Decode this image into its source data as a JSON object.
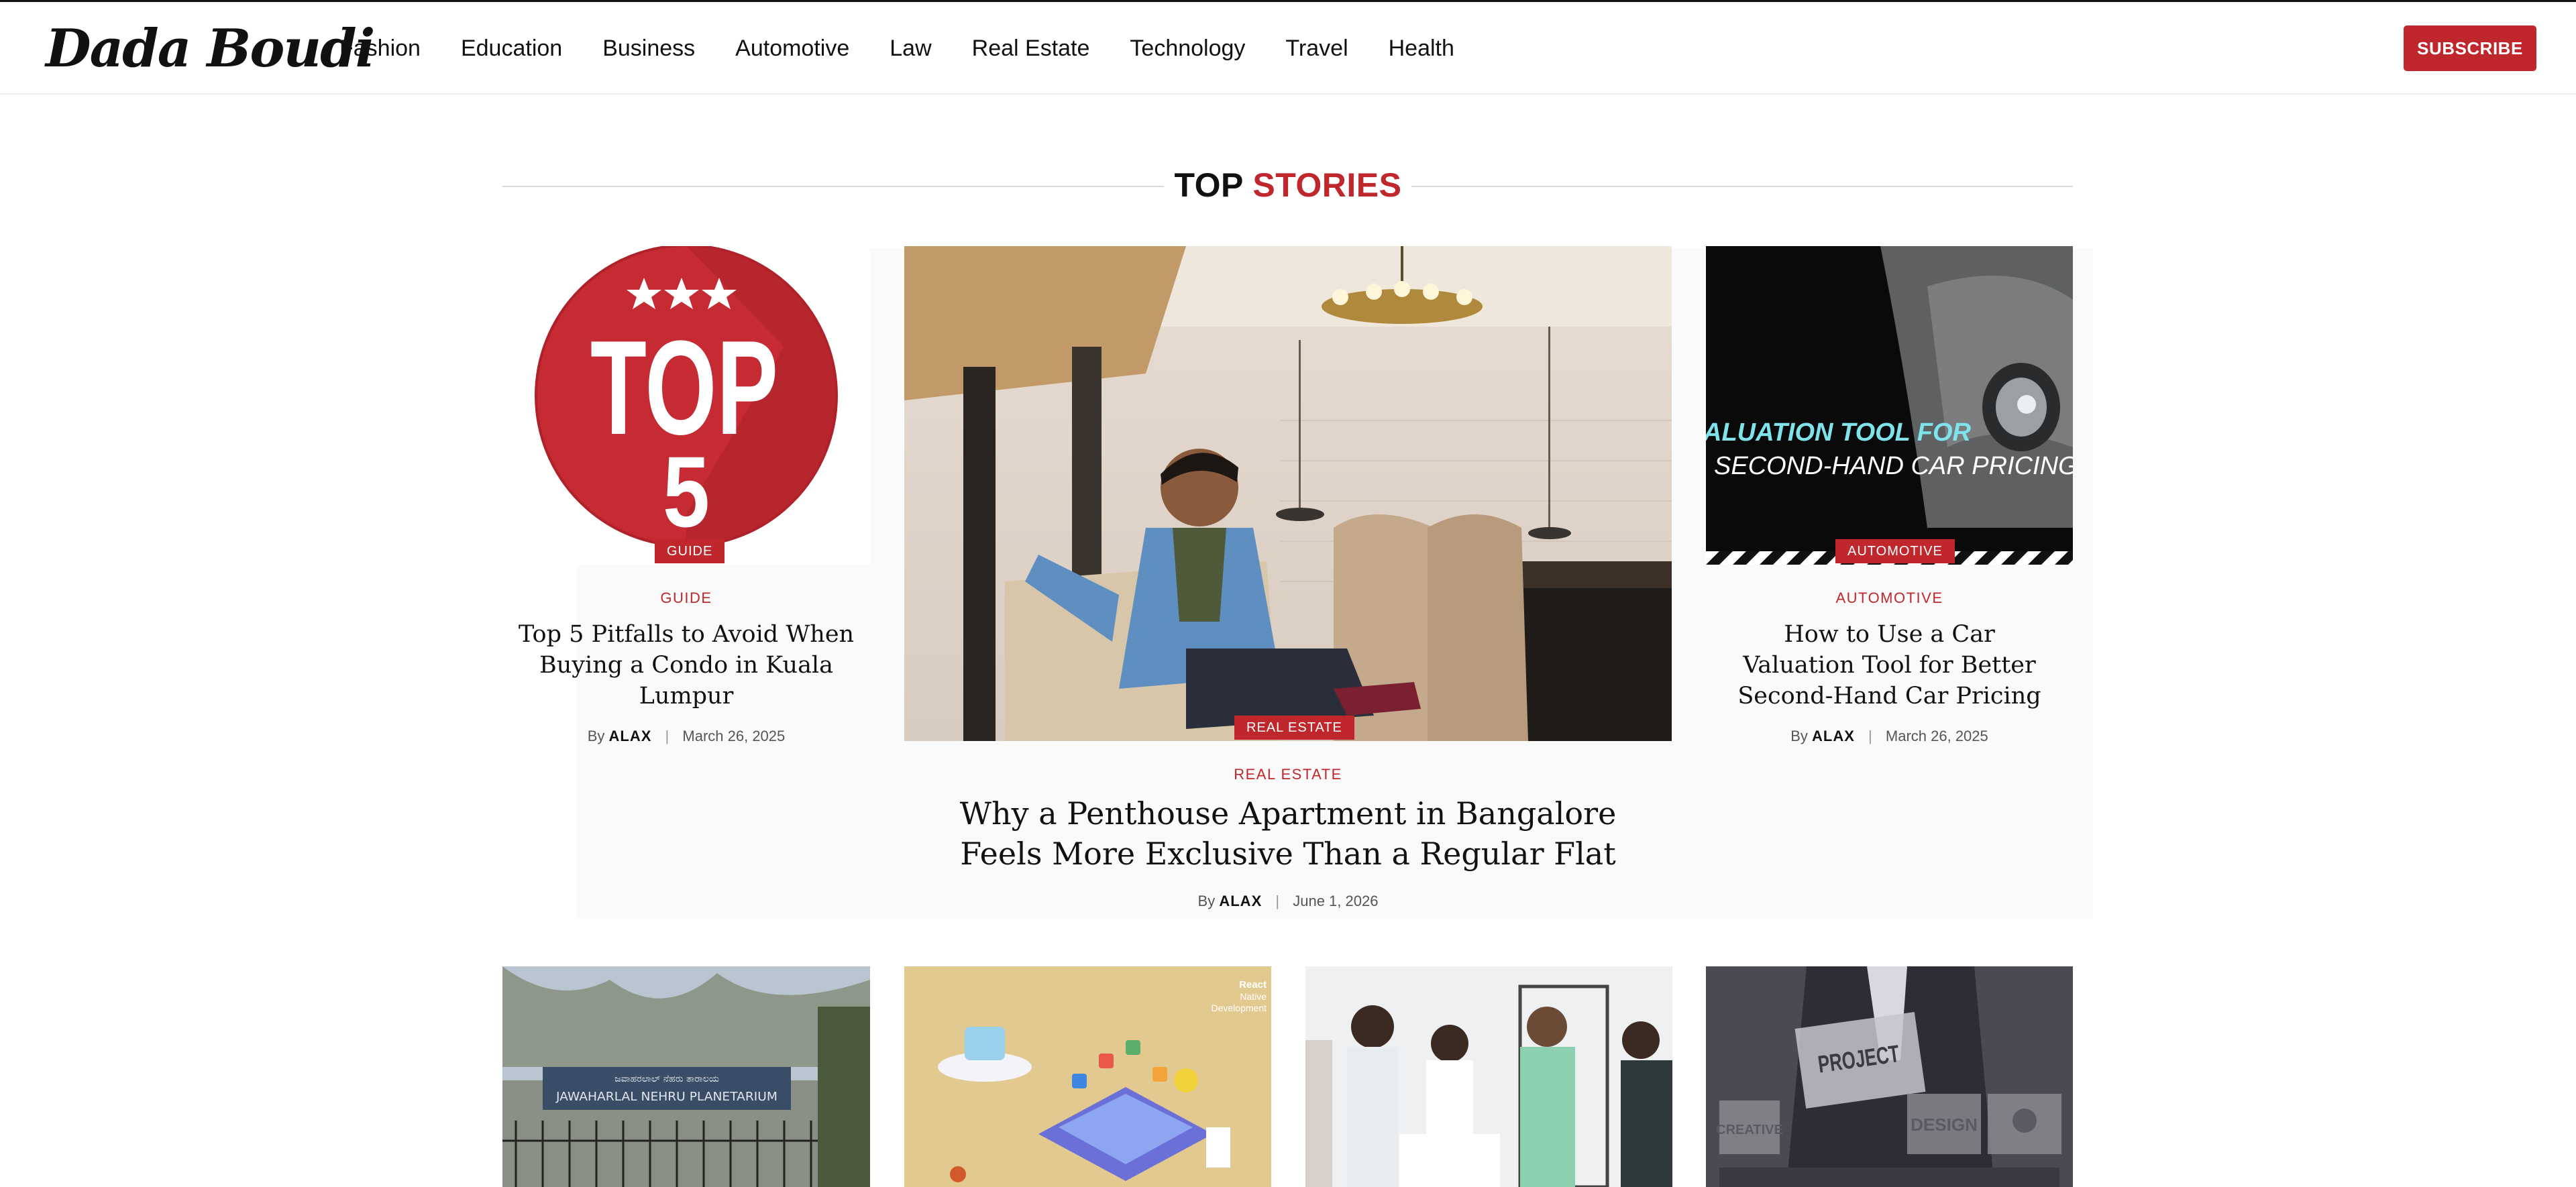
{
  "site": {
    "logo": "Dada Boudi",
    "nav": [
      "Fashion",
      "Education",
      "Business",
      "Automotive",
      "Law",
      "Real Estate",
      "Technology",
      "Travel",
      "Health"
    ],
    "subscribe_label": "SUBSCRIBE"
  },
  "section": {
    "title_main": "TOP",
    "title_accent": "STORIES"
  },
  "featured": {
    "left": {
      "category": "GUIDE",
      "badge_text": "TOP",
      "badge_number": "5",
      "title": "Top 5 Pitfalls to Avoid When Buying a Condo in Kuala Lumpur",
      "by": "By",
      "author": "ALAX",
      "date": "March 26, 2025"
    },
    "center": {
      "category": "REAL ESTATE",
      "title": "Why a Penthouse Apartment in Bangalore Feels More Exclusive Than a Regular Flat",
      "by": "By",
      "author": "ALAX",
      "date": "June 1, 2026"
    },
    "right": {
      "category": "AUTOMOTIVE",
      "image_text_line1": "ALUATION TOOL FOR",
      "image_text_line2": "SECOND-HAND CAR PRICING",
      "title": "How to Use a Car Valuation Tool for Better Second-Hand Car Pricing",
      "by": "By",
      "author": "ALAX",
      "date": "March 26, 2025"
    }
  },
  "row2": {
    "sign_line1": "ಜವಾಹರಲಾಲ್ ನೆಹರು ತಾರಾಲಯ",
    "sign_line2": "JAWAHARLAL NEHRU PLANETARIUM",
    "react_line1": "React",
    "react_line2": "Native",
    "react_line3": "Development",
    "project_label": "PROJECT",
    "creative_label": "CREATIVE",
    "design_label": "DESIGN"
  },
  "colors": {
    "accent": "#c0272d",
    "text": "#111111",
    "muted": "#555555"
  }
}
